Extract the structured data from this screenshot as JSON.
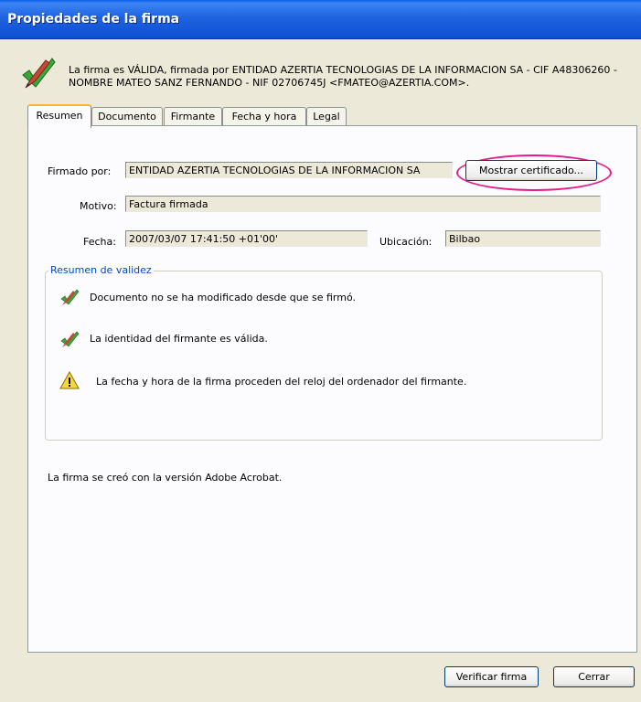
{
  "window": {
    "title": "Propiedades de la firma"
  },
  "status": {
    "icon": "pen-check-icon",
    "text": "La firma es VÁLIDA, firmada por ENTIDAD AZERTIA TECNOLOGIAS DE LA INFORMACION SA - CIF A48306260 - NOMBRE MATEO SANZ FERNANDO - NIF 02706745J <FMATEO@AZERTIA.COM>."
  },
  "tabs": [
    {
      "label": "Resumen",
      "active": true
    },
    {
      "label": "Documento",
      "active": false
    },
    {
      "label": "Firmante",
      "active": false
    },
    {
      "label": "Fecha y hora",
      "active": false
    },
    {
      "label": "Legal",
      "active": false
    }
  ],
  "summary": {
    "signed_by_label": "Firmado por:",
    "signed_by_value": "ENTIDAD AZERTIA TECNOLOGIAS DE LA INFORMACION SA",
    "show_cert_button": "Mostrar certificado...",
    "reason_label": "Motivo:",
    "reason_value": "Factura firmada",
    "date_label": "Fecha:",
    "date_value": "2007/03/07 17:41:50 +01'00'",
    "location_label": "Ubicación:",
    "location_value": "Bilbao"
  },
  "validity": {
    "title": "Resumen de validez",
    "items": [
      {
        "icon": "pen-check-icon",
        "text": "Documento no se ha modificado desde que se firmó."
      },
      {
        "icon": "pen-check-icon",
        "text": "La identidad del firmante es válida."
      },
      {
        "icon": "warning-icon",
        "text": "La fecha y hora de la firma proceden del reloj del ordenador del firmante."
      }
    ]
  },
  "footer_note": "La firma se creó con la versión Adobe Acrobat.",
  "buttons": {
    "verify": "Verificar firma",
    "close": "Cerrar"
  },
  "colors": {
    "titlebar": "#0c4fd2",
    "highlight": "#e8198b",
    "group_title": "#0046d5",
    "active_tab_accent": "#f9b53b"
  }
}
